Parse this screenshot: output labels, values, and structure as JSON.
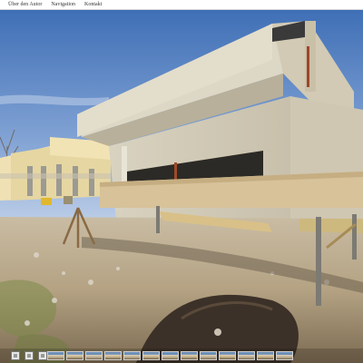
{
  "menu": {
    "items": [
      {
        "label": "Über den Autor"
      },
      {
        "label": "Navigation"
      },
      {
        "label": "Kontakt"
      }
    ]
  },
  "scene": {
    "description_icon": "panorama-photo"
  },
  "toolbar": {
    "buttons": [
      {
        "icon": "image-icon"
      },
      {
        "icon": "fullscreen-icon"
      },
      {
        "icon": "map-icon"
      }
    ],
    "thumbnail_count": 13
  },
  "colors": {
    "menubar_bg": "#ffffff",
    "menu_text": "#333333",
    "sky": "#5f86c4",
    "concrete": "#d7d0bd"
  }
}
